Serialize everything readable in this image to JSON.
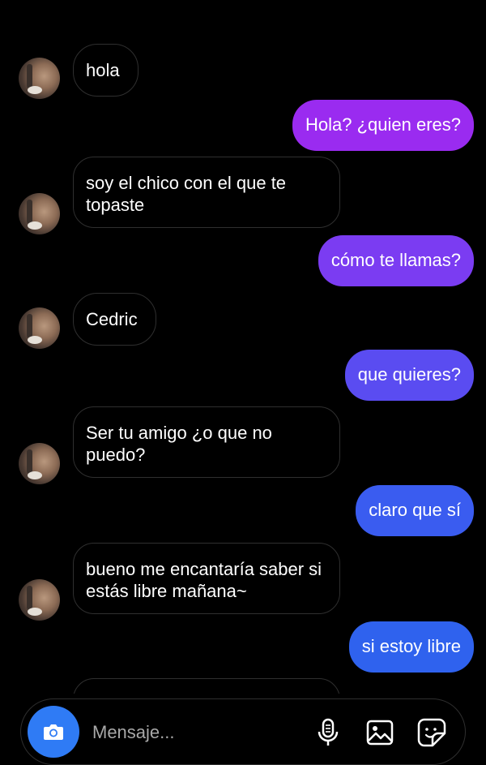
{
  "messages": [
    {
      "dir": "in",
      "text": "hola"
    },
    {
      "dir": "out",
      "text": "Hola? ¿quien eres?"
    },
    {
      "dir": "in",
      "text": "soy el chico con el que te topaste"
    },
    {
      "dir": "out",
      "text": "cómo te llamas?"
    },
    {
      "dir": "in",
      "text": "Cedric"
    },
    {
      "dir": "out",
      "text": "que quieres?"
    },
    {
      "dir": "in",
      "text": "Ser tu amigo ¿o que no puedo?"
    },
    {
      "dir": "out",
      "text": "claro que sí"
    },
    {
      "dir": "in",
      "text": "bueno me encantaría saber si estás libre mañana~"
    },
    {
      "dir": "out",
      "text": "si estoy libre"
    }
  ],
  "composer": {
    "placeholder": "Mensaje...",
    "camera_icon": "camera-icon",
    "microphone_icon": "microphone-icon",
    "gallery_icon": "gallery-icon",
    "sticker_icon": "sticker-icon"
  },
  "colors": {
    "background": "#000000",
    "incoming_border": "#2f2f2f",
    "outgoing_gradient": [
      "#9a2bf0",
      "#7b3cf2",
      "#5a4cf1",
      "#3a5cf0",
      "#2f62ee",
      "#1f6ce9"
    ],
    "camera_button": "#2f7bf5"
  }
}
